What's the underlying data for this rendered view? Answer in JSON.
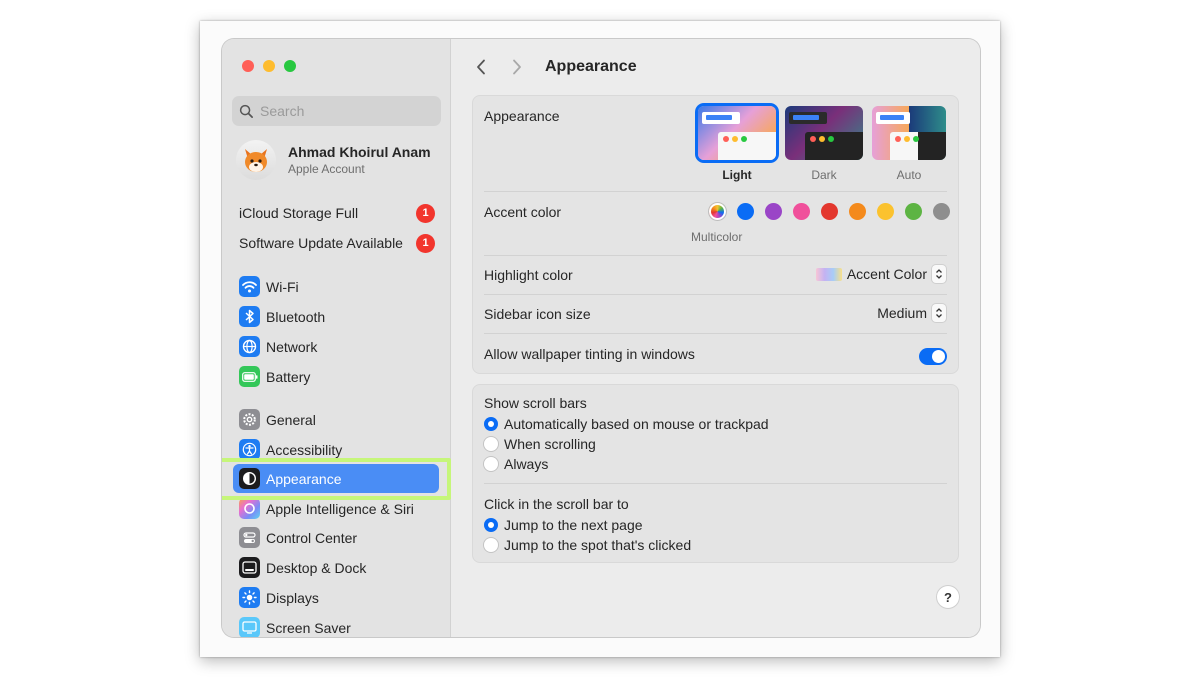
{
  "sidebar": {
    "search_placeholder": "Search",
    "account": {
      "name": "Ahmad Khoirul Anam",
      "subtitle": "Apple Account",
      "avatar_icon": "fox-memoji-icon"
    },
    "notices": [
      {
        "label": "iCloud Storage Full",
        "badge": "1"
      },
      {
        "label": "Software Update Available",
        "badge": "1"
      }
    ],
    "items": [
      {
        "label": "Wi-Fi",
        "icon": "wifi-icon",
        "color": "#1e7cf2"
      },
      {
        "label": "Bluetooth",
        "icon": "bluetooth-icon",
        "color": "#1e7cf2"
      },
      {
        "label": "Network",
        "icon": "globe-icon",
        "color": "#1e7cf2"
      },
      {
        "label": "Battery",
        "icon": "battery-icon",
        "color": "#34c759"
      },
      {
        "label": "General",
        "icon": "gear-icon",
        "color": "#8e8e93"
      },
      {
        "label": "Accessibility",
        "icon": "accessibility-icon",
        "color": "#1e7cf2"
      },
      {
        "label": "Appearance",
        "icon": "appearance-icon",
        "color": "#1c1c1e"
      },
      {
        "label": "Apple Intelligence & Siri",
        "icon": "siri-icon",
        "color": "#e9a5f2"
      },
      {
        "label": "Control Center",
        "icon": "control-center-icon",
        "color": "#8e8e93"
      },
      {
        "label": "Desktop & Dock",
        "icon": "dock-icon",
        "color": "#1c1c1e"
      },
      {
        "label": "Displays",
        "icon": "sun-icon",
        "color": "#1e7cf2"
      },
      {
        "label": "Screen Saver",
        "icon": "screen-saver-icon",
        "color": "#5ac8fa"
      }
    ],
    "selected_item": "Appearance"
  },
  "main": {
    "title": "Appearance",
    "appearance": {
      "label": "Appearance",
      "options": [
        "Light",
        "Dark",
        "Auto"
      ],
      "selected": "Light"
    },
    "accent": {
      "label": "Accent color",
      "selected_name": "Multicolor",
      "colors": [
        "#0a6cf5",
        "#9a45c7",
        "#f0509b",
        "#e3372e",
        "#f48a1c",
        "#fbc22e",
        "#5db443",
        "#8e8e8e"
      ]
    },
    "highlight": {
      "label": "Highlight color",
      "value": "Accent Color"
    },
    "sidebar_icon_size": {
      "label": "Sidebar icon size",
      "value": "Medium"
    },
    "wallpaper_tinting": {
      "label": "Allow wallpaper tinting in windows",
      "enabled": true
    },
    "scroll_bars": {
      "label": "Show scroll bars",
      "options": [
        "Automatically based on mouse or trackpad",
        "When scrolling",
        "Always"
      ],
      "selected": "Automatically based on mouse or trackpad"
    },
    "click_scroll": {
      "label": "Click in the scroll bar to",
      "options": [
        "Jump to the next page",
        "Jump to the spot that's clicked"
      ],
      "selected": "Jump to the next page"
    },
    "help_label": "?"
  }
}
